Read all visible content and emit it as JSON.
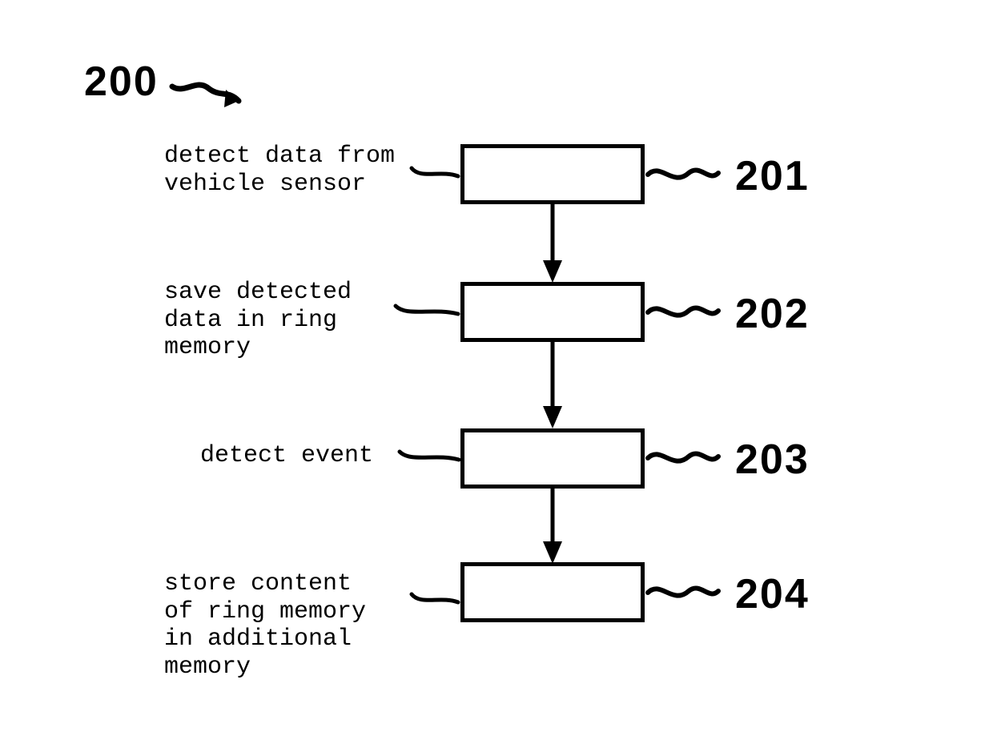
{
  "diagram": {
    "title_ref": "200",
    "steps": [
      {
        "ref": "201",
        "desc": "detect data from\nvehicle sensor"
      },
      {
        "ref": "202",
        "desc": "save detected\ndata in ring\nmemory"
      },
      {
        "ref": "203",
        "desc": "detect event"
      },
      {
        "ref": "204",
        "desc": "store content\nof ring memory\nin additional\nmemory"
      }
    ]
  }
}
